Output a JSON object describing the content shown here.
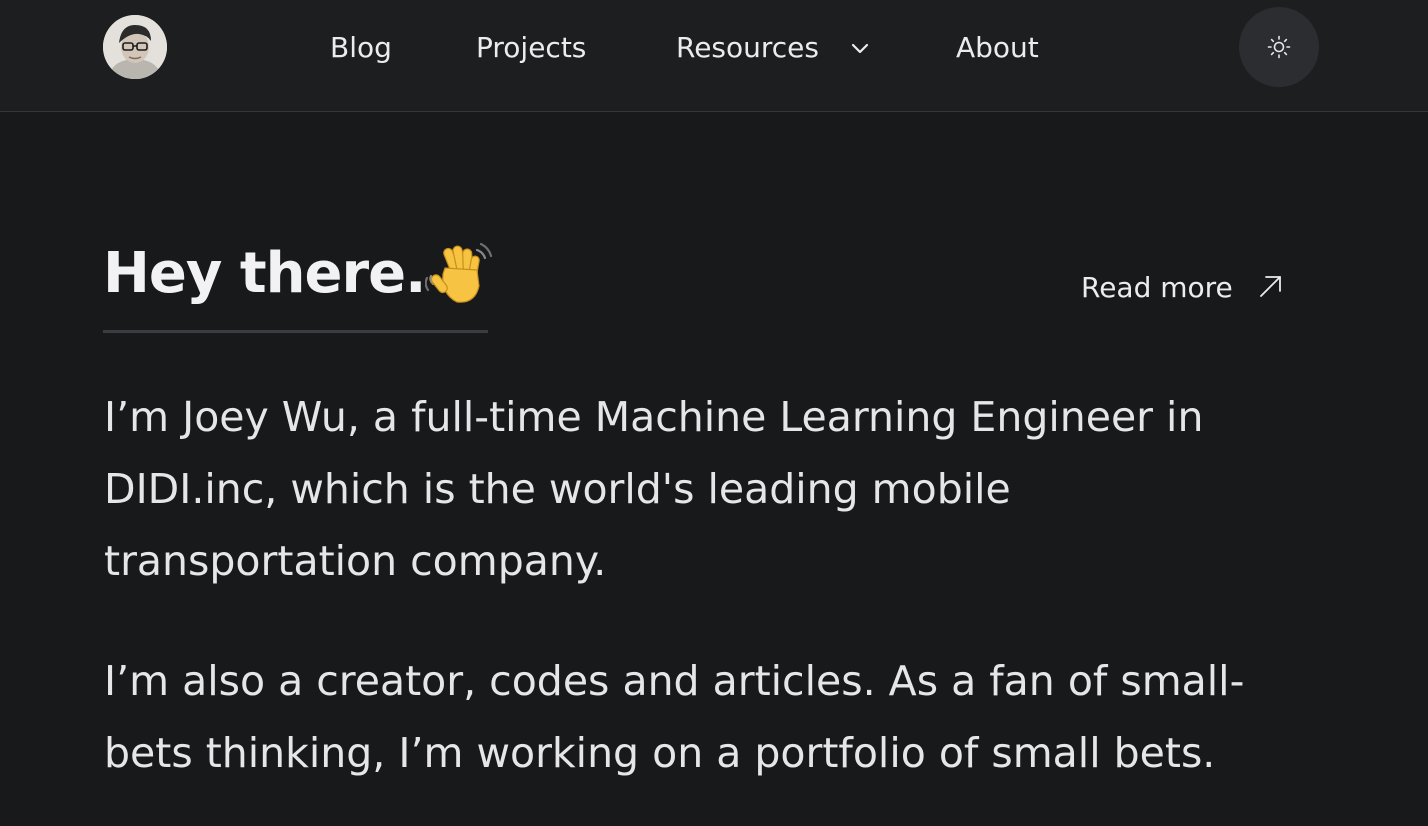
{
  "header": {
    "avatar_alt": "Joey Wu avatar",
    "nav": [
      {
        "label": "Blog"
      },
      {
        "label": "Projects"
      },
      {
        "label": "Resources",
        "has_dropdown": true
      },
      {
        "label": "About"
      }
    ],
    "theme_toggle_icon": "sun-icon"
  },
  "hero": {
    "title": "Hey there.",
    "emoji_icon": "waving-hand-icon",
    "read_more": "Read more",
    "read_more_icon": "arrow-up-right-icon"
  },
  "intro": {
    "paragraph_1": "I’m Joey Wu, a full-time Machine Learning Engineer in DIDI.inc, which is the world's leading mobile transportation company.",
    "paragraph_2": "I’m also a creator, codes and articles. As a fan of small-bets thinking, I’m working on a portfolio of small bets."
  },
  "colors": {
    "background": "#18191b",
    "header_background": "#1d1e20",
    "text": "#e8e8ea",
    "theme_button_bg": "#2c2d30"
  }
}
